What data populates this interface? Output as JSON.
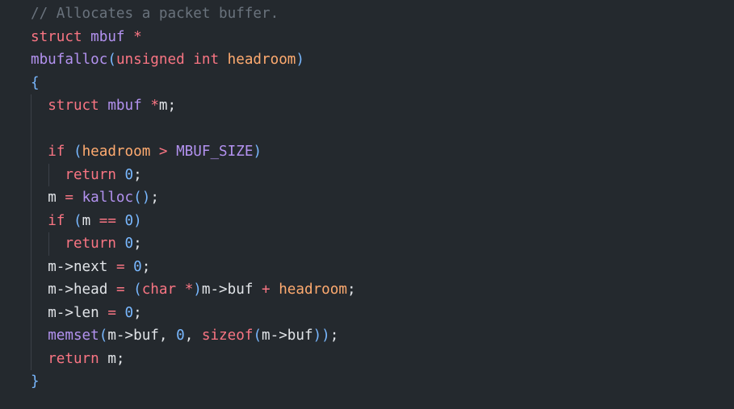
{
  "editor": {
    "lines": [
      [
        {
          "t": "// Allocates a packet buffer.",
          "k": "comment"
        }
      ],
      [
        {
          "t": "struct",
          "k": "keyword"
        },
        {
          "t": " ",
          "k": "plain"
        },
        {
          "t": "mbuf",
          "k": "type"
        },
        {
          "t": " ",
          "k": "plain"
        },
        {
          "t": "*",
          "k": "keyword"
        }
      ],
      [
        {
          "t": "mbufalloc",
          "k": "func"
        },
        {
          "t": "(",
          "k": "paren"
        },
        {
          "t": "unsigned",
          "k": "keyword"
        },
        {
          "t": " ",
          "k": "plain"
        },
        {
          "t": "int",
          "k": "keyword"
        },
        {
          "t": " ",
          "k": "plain"
        },
        {
          "t": "headroom",
          "k": "param"
        },
        {
          "t": ")",
          "k": "paren"
        }
      ],
      [
        {
          "t": "{",
          "k": "brace"
        }
      ],
      [
        {
          "t": "  ",
          "k": "plain"
        },
        {
          "t": "struct",
          "k": "keyword"
        },
        {
          "t": " ",
          "k": "plain"
        },
        {
          "t": "mbuf",
          "k": "type"
        },
        {
          "t": " ",
          "k": "plain"
        },
        {
          "t": "*",
          "k": "keyword"
        },
        {
          "t": "m;",
          "k": "plain"
        }
      ],
      [],
      [
        {
          "t": "  ",
          "k": "plain"
        },
        {
          "t": "if",
          "k": "keyword"
        },
        {
          "t": " ",
          "k": "plain"
        },
        {
          "t": "(",
          "k": "paren"
        },
        {
          "t": "headroom",
          "k": "param"
        },
        {
          "t": " ",
          "k": "plain"
        },
        {
          "t": ">",
          "k": "keyword"
        },
        {
          "t": " ",
          "k": "plain"
        },
        {
          "t": "MBUF_SIZE",
          "k": "const"
        },
        {
          "t": ")",
          "k": "paren"
        }
      ],
      [
        {
          "t": "    ",
          "k": "plain"
        },
        {
          "t": "return",
          "k": "keyword"
        },
        {
          "t": " ",
          "k": "plain"
        },
        {
          "t": "0",
          "k": "num"
        },
        {
          "t": ";",
          "k": "plain"
        }
      ],
      [
        {
          "t": "  ",
          "k": "plain"
        },
        {
          "t": "m",
          "k": "plain"
        },
        {
          "t": " ",
          "k": "plain"
        },
        {
          "t": "=",
          "k": "keyword"
        },
        {
          "t": " ",
          "k": "plain"
        },
        {
          "t": "kalloc",
          "k": "func"
        },
        {
          "t": "()",
          "k": "paren"
        },
        {
          "t": ";",
          "k": "plain"
        }
      ],
      [
        {
          "t": "  ",
          "k": "plain"
        },
        {
          "t": "if",
          "k": "keyword"
        },
        {
          "t": " ",
          "k": "plain"
        },
        {
          "t": "(",
          "k": "paren"
        },
        {
          "t": "m",
          "k": "plain"
        },
        {
          "t": " ",
          "k": "plain"
        },
        {
          "t": "==",
          "k": "keyword"
        },
        {
          "t": " ",
          "k": "plain"
        },
        {
          "t": "0",
          "k": "num"
        },
        {
          "t": ")",
          "k": "paren"
        }
      ],
      [
        {
          "t": "    ",
          "k": "plain"
        },
        {
          "t": "return",
          "k": "keyword"
        },
        {
          "t": " ",
          "k": "plain"
        },
        {
          "t": "0",
          "k": "num"
        },
        {
          "t": ";",
          "k": "plain"
        }
      ],
      [
        {
          "t": "  ",
          "k": "plain"
        },
        {
          "t": "m->next",
          "k": "plain"
        },
        {
          "t": " ",
          "k": "plain"
        },
        {
          "t": "=",
          "k": "keyword"
        },
        {
          "t": " ",
          "k": "plain"
        },
        {
          "t": "0",
          "k": "num"
        },
        {
          "t": ";",
          "k": "plain"
        }
      ],
      [
        {
          "t": "  ",
          "k": "plain"
        },
        {
          "t": "m->head",
          "k": "plain"
        },
        {
          "t": " ",
          "k": "plain"
        },
        {
          "t": "=",
          "k": "keyword"
        },
        {
          "t": " ",
          "k": "plain"
        },
        {
          "t": "(",
          "k": "paren"
        },
        {
          "t": "char",
          "k": "keyword"
        },
        {
          "t": " ",
          "k": "plain"
        },
        {
          "t": "*",
          "k": "keyword"
        },
        {
          "t": ")",
          "k": "paren"
        },
        {
          "t": "m->buf",
          "k": "plain"
        },
        {
          "t": " ",
          "k": "plain"
        },
        {
          "t": "+",
          "k": "keyword"
        },
        {
          "t": " ",
          "k": "plain"
        },
        {
          "t": "headroom",
          "k": "param"
        },
        {
          "t": ";",
          "k": "plain"
        }
      ],
      [
        {
          "t": "  ",
          "k": "plain"
        },
        {
          "t": "m->len",
          "k": "plain"
        },
        {
          "t": " ",
          "k": "plain"
        },
        {
          "t": "=",
          "k": "keyword"
        },
        {
          "t": " ",
          "k": "plain"
        },
        {
          "t": "0",
          "k": "num"
        },
        {
          "t": ";",
          "k": "plain"
        }
      ],
      [
        {
          "t": "  ",
          "k": "plain"
        },
        {
          "t": "memset",
          "k": "func"
        },
        {
          "t": "(",
          "k": "paren"
        },
        {
          "t": "m->buf, ",
          "k": "plain"
        },
        {
          "t": "0",
          "k": "num"
        },
        {
          "t": ", ",
          "k": "plain"
        },
        {
          "t": "sizeof",
          "k": "keyword"
        },
        {
          "t": "(",
          "k": "paren"
        },
        {
          "t": "m->buf",
          "k": "plain"
        },
        {
          "t": "))",
          "k": "paren"
        },
        {
          "t": ";",
          "k": "plain"
        }
      ],
      [
        {
          "t": "  ",
          "k": "plain"
        },
        {
          "t": "return",
          "k": "keyword"
        },
        {
          "t": " ",
          "k": "plain"
        },
        {
          "t": "m;",
          "k": "plain"
        }
      ],
      [
        {
          "t": "}",
          "k": "brace"
        }
      ]
    ],
    "indent_guides": [
      0,
      0,
      0,
      0,
      1,
      1,
      1,
      2,
      1,
      1,
      2,
      1,
      1,
      1,
      1,
      1,
      0
    ]
  },
  "colors": {
    "background": "#24292e",
    "comment": "#6a737d",
    "keyword": "#f97583",
    "type": "#b392f0",
    "function": "#b392f0",
    "parameter": "#ffab70",
    "constant": "#b392f0",
    "number": "#79b8ff",
    "plain": "#e1e4e8"
  }
}
